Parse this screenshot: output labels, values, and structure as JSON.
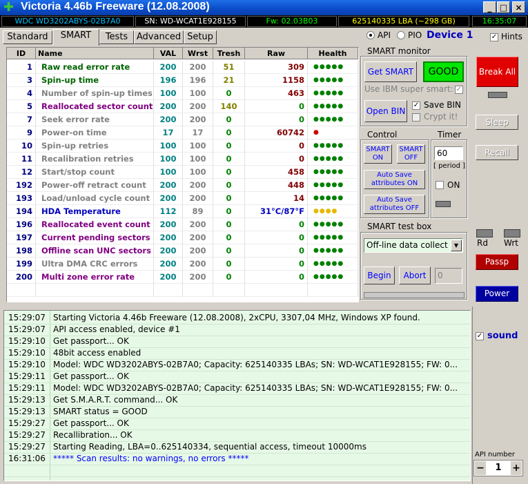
{
  "window": {
    "title": "Victoria 4.46b Freeware (12.08.2008)",
    "min": "_",
    "max": "□",
    "close": "×"
  },
  "infobar": {
    "model": "WDC WD3202ABYS-02B7A0",
    "serial": "SN: WD-WCAT1E928155",
    "firmware": "Fw: 02.03B03",
    "lba": "625140335 LBA (~298 GB)",
    "clock": "16:35:07"
  },
  "tabs": [
    "Standard",
    "SMART",
    "Tests",
    "Advanced",
    "Setup"
  ],
  "access": {
    "api": "API",
    "pio": "PIO",
    "device": "Device 1",
    "hints": "Hints"
  },
  "table": {
    "headers": [
      "ID",
      "Name",
      "VAL",
      "Wrst",
      "Tresh",
      "Raw",
      "Health"
    ],
    "rows": [
      {
        "id": "1",
        "name": "Raw read error rate",
        "val": "200",
        "wrst": "200",
        "tresh": "51",
        "raw": "309",
        "health": "●●●●●",
        "nc": "#006400",
        "rc": "#800000",
        "tc": "#808000",
        "hc": "#008000"
      },
      {
        "id": "3",
        "name": "Spin-up time",
        "val": "196",
        "wrst": "196",
        "tresh": "21",
        "raw": "1158",
        "health": "●●●●●",
        "nc": "#006400",
        "rc": "#800000",
        "tc": "#808000",
        "hc": "#008000"
      },
      {
        "id": "4",
        "name": "Number of spin-up times",
        "val": "100",
        "wrst": "100",
        "tresh": "0",
        "raw": "463",
        "health": "●●●●●",
        "nc": "#808080",
        "rc": "#800000",
        "tc": "#008000",
        "hc": "#008000"
      },
      {
        "id": "5",
        "name": "Reallocated sector count",
        "val": "200",
        "wrst": "200",
        "tresh": "140",
        "raw": "0",
        "health": "●●●●●",
        "nc": "#800080",
        "rc": "#008000",
        "tc": "#808000",
        "hc": "#008000"
      },
      {
        "id": "7",
        "name": "Seek error rate",
        "val": "200",
        "wrst": "200",
        "tresh": "0",
        "raw": "0",
        "health": "●●●●●",
        "nc": "#808080",
        "rc": "#008000",
        "tc": "#008000",
        "hc": "#008000"
      },
      {
        "id": "9",
        "name": "Power-on time",
        "val": "17",
        "wrst": "17",
        "tresh": "0",
        "raw": "60742",
        "health": "●",
        "nc": "#808080",
        "rc": "#800000",
        "tc": "#008000",
        "hc": "#d00000"
      },
      {
        "id": "10",
        "name": "Spin-up retries",
        "val": "100",
        "wrst": "100",
        "tresh": "0",
        "raw": "0",
        "health": "●●●●●",
        "nc": "#808080",
        "rc": "#800000",
        "tc": "#008000",
        "hc": "#008000"
      },
      {
        "id": "11",
        "name": "Recalibration retries",
        "val": "100",
        "wrst": "100",
        "tresh": "0",
        "raw": "0",
        "health": "●●●●●",
        "nc": "#808080",
        "rc": "#800000",
        "tc": "#008000",
        "hc": "#008000"
      },
      {
        "id": "12",
        "name": "Start/stop count",
        "val": "100",
        "wrst": "100",
        "tresh": "0",
        "raw": "458",
        "health": "●●●●●",
        "nc": "#808080",
        "rc": "#800000",
        "tc": "#008000",
        "hc": "#008000"
      },
      {
        "id": "192",
        "name": "Power-off retract count",
        "val": "200",
        "wrst": "200",
        "tresh": "0",
        "raw": "448",
        "health": "●●●●●",
        "nc": "#808080",
        "rc": "#800000",
        "tc": "#008000",
        "hc": "#008000"
      },
      {
        "id": "193",
        "name": "Load/unload cycle count",
        "val": "200",
        "wrst": "200",
        "tresh": "0",
        "raw": "14",
        "health": "●●●●●",
        "nc": "#808080",
        "rc": "#800000",
        "tc": "#008000",
        "hc": "#008000"
      },
      {
        "id": "194",
        "name": "HDA Temperature",
        "val": "112",
        "wrst": "89",
        "tresh": "0",
        "raw": "31°C/87°F",
        "health": "●●●●",
        "nc": "#0000c0",
        "rc": "#0000c0",
        "tc": "#008000",
        "hc": "#e8b800"
      },
      {
        "id": "196",
        "name": "Reallocated event count",
        "val": "200",
        "wrst": "200",
        "tresh": "0",
        "raw": "0",
        "health": "●●●●●",
        "nc": "#800080",
        "rc": "#008000",
        "tc": "#008000",
        "hc": "#008000"
      },
      {
        "id": "197",
        "name": "Current pending sectors",
        "val": "200",
        "wrst": "200",
        "tresh": "0",
        "raw": "0",
        "health": "●●●●●",
        "nc": "#800080",
        "rc": "#008000",
        "tc": "#008000",
        "hc": "#008000"
      },
      {
        "id": "198",
        "name": "Offline scan UNC sectors",
        "val": "200",
        "wrst": "200",
        "tresh": "0",
        "raw": "0",
        "health": "●●●●●",
        "nc": "#800080",
        "rc": "#008000",
        "tc": "#008000",
        "hc": "#008000"
      },
      {
        "id": "199",
        "name": "Ultra DMA CRC errors",
        "val": "200",
        "wrst": "200",
        "tresh": "0",
        "raw": "0",
        "health": "●●●●●",
        "nc": "#808080",
        "rc": "#008000",
        "tc": "#008000",
        "hc": "#008000"
      },
      {
        "id": "200",
        "name": "Multi zone error rate",
        "val": "200",
        "wrst": "200",
        "tresh": "0",
        "raw": "0",
        "health": "●●●●●",
        "nc": "#800080",
        "rc": "#008000",
        "tc": "#008000",
        "hc": "#008000"
      }
    ]
  },
  "smart_monitor": {
    "title": "SMART monitor",
    "get_smart": "Get SMART",
    "status": "GOOD",
    "ibm_label": "Use IBM super smart:",
    "open_bin": "Open BIN",
    "save_bin": "Save BIN",
    "crypt": "Crypt it!"
  },
  "control": {
    "title": "Control",
    "smart_on": "SMART ON",
    "smart_off": "SMART OFF",
    "autosave_on": "Auto Save attributes ON",
    "autosave_off": "Auto Save attributes OFF"
  },
  "timer": {
    "title": "Timer",
    "value": "60",
    "period": "[ period ]",
    "on": "ON"
  },
  "testbox": {
    "title": "SMART test box",
    "selected": "Off-line data collect",
    "begin": "Begin",
    "abort": "Abort",
    "value": "0"
  },
  "side": {
    "break_all": "Break All",
    "sleep": "Sleep",
    "recall": "Recall",
    "rd": "Rd",
    "wrt": "Wrt",
    "passp": "Passp",
    "power": "Power",
    "sound": "sound",
    "api_number_label": "API number",
    "api_number": "1",
    "minus": "−",
    "plus": "+"
  },
  "log": [
    {
      "t": "15:29:07",
      "m": "Starting Victoria 4.46b Freeware (12.08.2008), 2xCPU, 3307,04 MHz, Windows XP found.",
      "c": "#000"
    },
    {
      "t": "15:29:07",
      "m": "API access enabled, device #1",
      "c": "#000"
    },
    {
      "t": "15:29:10",
      "m": "Get passport... OK",
      "c": "#000"
    },
    {
      "t": "15:29:10",
      "m": "48bit access enabled",
      "c": "#000"
    },
    {
      "t": "15:29:10",
      "m": "Model: WDC WD3202ABYS-02B7A0; Capacity: 625140335 LBAs; SN: WD-WCAT1E928155; FW: 0...",
      "c": "#000"
    },
    {
      "t": "15:29:11",
      "m": "Get passport... OK",
      "c": "#000"
    },
    {
      "t": "15:29:11",
      "m": "Model: WDC WD3202ABYS-02B7A0; Capacity: 625140335 LBAs; SN: WD-WCAT1E928155; FW: 0...",
      "c": "#000"
    },
    {
      "t": "15:29:13",
      "m": "Get S.M.A.R.T. command... OK",
      "c": "#000"
    },
    {
      "t": "15:29:13",
      "m": "SMART status = GOOD",
      "c": "#000"
    },
    {
      "t": "15:29:27",
      "m": "Get passport... OK",
      "c": "#000"
    },
    {
      "t": "15:29:27",
      "m": "Recallibration... OK",
      "c": "#000"
    },
    {
      "t": "15:29:27",
      "m": "Starting Reading, LBA=0..625140334, sequential access, timeout 10000ms",
      "c": "#000"
    },
    {
      "t": "16:31:06",
      "m": "***** Scan results: no warnings, no errors *****",
      "c": "#0000ff"
    }
  ]
}
